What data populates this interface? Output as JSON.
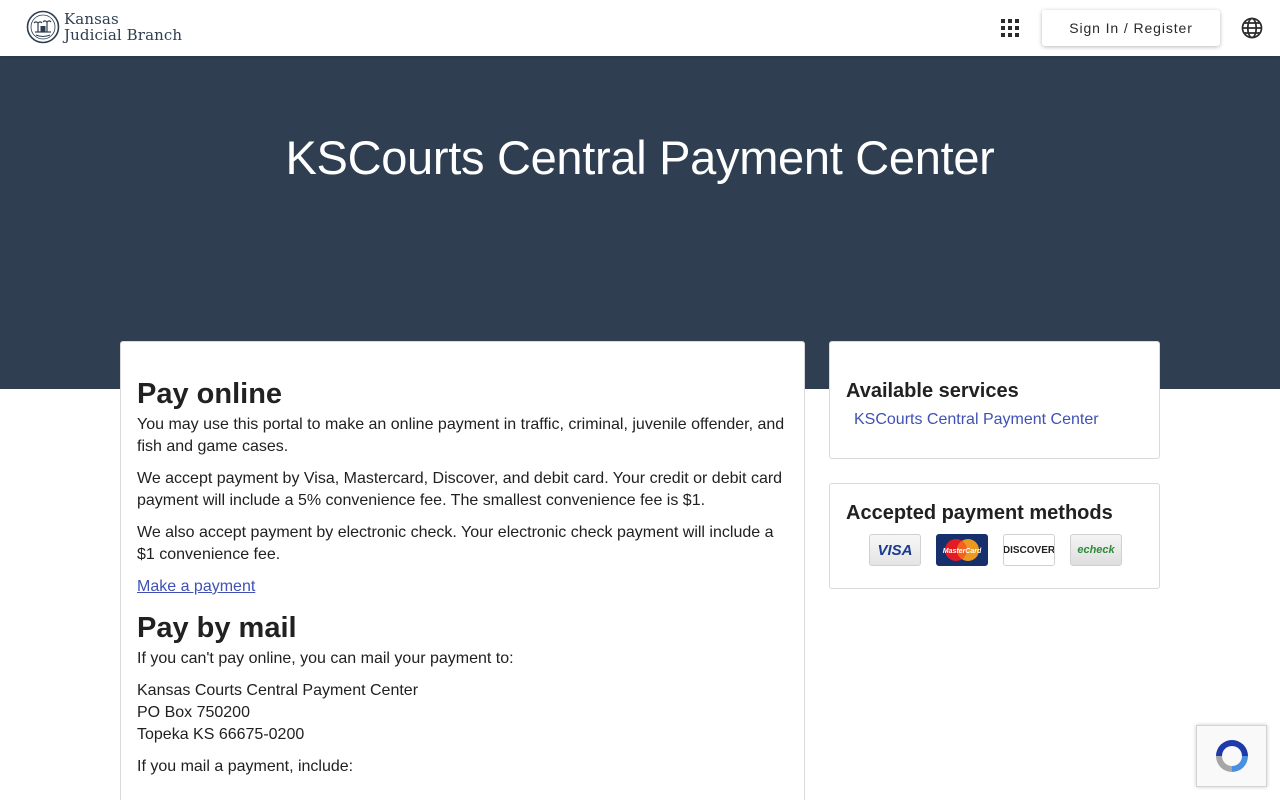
{
  "header": {
    "logo_line1": "Kansas",
    "logo_line2": "Judicial Branch",
    "signin_label": "Sign In / Register",
    "icons": {
      "apps": "apps-grid-icon",
      "language": "globe-icon"
    }
  },
  "hero": {
    "title": "KSCourts Central Payment Center"
  },
  "main": {
    "pay_online": {
      "heading": "Pay online",
      "p1": "You may use this portal to make an online payment in traffic, criminal, juvenile offender, and fish and game cases.",
      "p2": "We accept payment by Visa, Mastercard, Discover, and debit card. Your credit or debit card payment will include a 5% convenience fee. The smallest convenience fee is $1.",
      "p3": "We also accept payment by electronic check. Your electronic check payment will include a $1 convenience fee.",
      "link": "Make a payment"
    },
    "pay_mail": {
      "heading": "Pay by mail",
      "intro": "If you can't pay online, you can mail your payment to:",
      "address": [
        "Kansas Courts Central Payment Center",
        "PO Box 750200",
        "Topeka KS 66675-0200"
      ],
      "include": "If you mail a payment, include:"
    }
  },
  "sidebar": {
    "services": {
      "heading": "Available services",
      "link": "KSCourts Central Payment Center"
    },
    "methods": {
      "heading": "Accepted payment methods",
      "logos": [
        {
          "name": "visa",
          "text": "VISA"
        },
        {
          "name": "mastercard",
          "text": "MasterCard"
        },
        {
          "name": "discover",
          "text": "DISCOVER"
        },
        {
          "name": "echeck",
          "text": "echeck"
        }
      ]
    }
  },
  "colors": {
    "hero_bg": "#2f3e50",
    "link": "#3f51b5",
    "text": "#212121"
  }
}
